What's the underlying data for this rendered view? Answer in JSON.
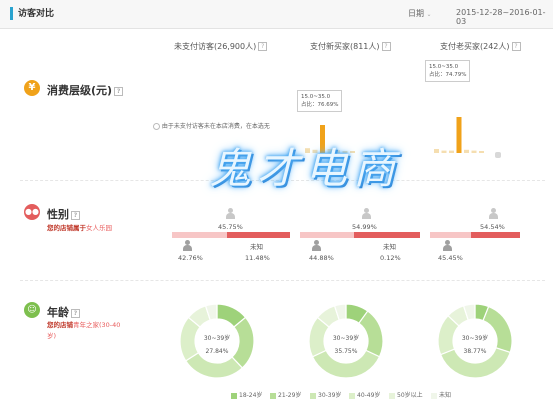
{
  "header": {
    "title": "访客对比",
    "date_label": "日期",
    "date_range": "2015-12-28~2016-01-03"
  },
  "columns": [
    {
      "label": "未支付访客(26,900人)"
    },
    {
      "label": "支付新买家(811人)"
    },
    {
      "label": "支付老买家(242人)"
    }
  ],
  "spend": {
    "title": "消费层级(元)",
    "no_data_note": "由于未支付访客未在本店消费，在本选无",
    "columns": [
      {
        "bars": [
          0.12,
          0.08,
          0.7,
          0.1,
          0.07,
          0.05,
          0.05
        ],
        "tooltip": [
          "15.0~35.0",
          "占比：76.69%"
        ]
      },
      {
        "bars": [
          0.1,
          0.06,
          0.06,
          0.9,
          0.08,
          0.06,
          0.05
        ],
        "tooltip": [
          "15.0~35.0",
          "占比：74.79%"
        ]
      }
    ]
  },
  "gender": {
    "title": "性别",
    "note_prefix": "您的店铺属于",
    "note_highlight": "女人乐园",
    "columns": [
      {
        "female_pct_label": "45.75%",
        "male_pct_label": "42.76%",
        "unknown_label": "未知",
        "unknown_pct_label": "11.48%",
        "male": 0.4276,
        "female": 0.4575
      },
      {
        "female_pct_label": "54.99%",
        "male_pct_label": "44.88%",
        "unknown_label": "未知",
        "unknown_pct_label": "0.12%",
        "male": 0.4488,
        "female": 0.5499
      },
      {
        "female_pct_label": "54.54%",
        "male_pct_label": "45.45%",
        "unknown_label": "",
        "unknown_pct_label": "",
        "male": 0.4545,
        "female": 0.5454
      }
    ]
  },
  "age": {
    "title": "年龄",
    "note_prefix": "您的店铺",
    "note_highlight": "青年之家(30-40",
    "note_suffix": "岁)",
    "donuts": [
      {
        "center_label": "30~39岁",
        "center_value": "27.84%",
        "segments": [
          0.14,
          0.24,
          0.28,
          0.2,
          0.09,
          0.05
        ]
      },
      {
        "center_label": "30~39岁",
        "center_value": "35.75%",
        "segments": [
          0.1,
          0.22,
          0.36,
          0.18,
          0.09,
          0.05
        ]
      },
      {
        "center_label": "30~39岁",
        "center_value": "38.77%",
        "segments": [
          0.06,
          0.24,
          0.39,
          0.18,
          0.08,
          0.05
        ]
      }
    ],
    "legend": [
      {
        "label": "18-24岁",
        "color": "#9ed27a"
      },
      {
        "label": "21-29岁",
        "color": "#b7de97"
      },
      {
        "label": "30-39岁",
        "color": "#cde8b4"
      },
      {
        "label": "40-49岁",
        "color": "#dcefc9"
      },
      {
        "label": "50岁以上",
        "color": "#e7f3da"
      },
      {
        "label": "未知",
        "color": "#f0f6ea"
      }
    ]
  },
  "colors": {
    "accent": "#2aa3cf",
    "spend_icon": "#f0a21a",
    "gender_icon": "#e35d5d",
    "age_icon": "#7dbf4e",
    "bar_highlight": "#f0a21a",
    "bar_normal": "#f5deb0"
  },
  "watermark": "鬼才电商",
  "help_mark": "?",
  "icons": {
    "spend": "yuan-icon",
    "gender": "people-icon",
    "age": "age-icon"
  }
}
